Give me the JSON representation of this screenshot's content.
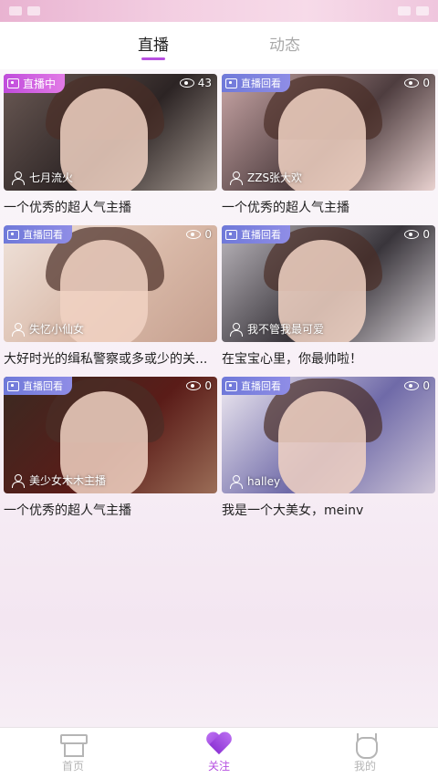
{
  "status_bar": {
    "left_text": "",
    "right_text": ""
  },
  "tabs": [
    {
      "label": "直播",
      "active": true
    },
    {
      "label": "动态",
      "active": false
    }
  ],
  "cards": [
    {
      "badge": "直播中",
      "badge_type": "live",
      "viewers": "43",
      "host": "七月流火",
      "title": "一个优秀的超人气主播",
      "bg": [
        "#6b5a55",
        "#2c2424",
        "#a39890"
      ]
    },
    {
      "badge": "直播回看",
      "badge_type": "replay",
      "viewers": "0",
      "host": "ZZS张大欢",
      "title": "一个优秀的超人气主播",
      "bg": [
        "#caa7a7",
        "#4e3d3f",
        "#e9d2d0"
      ]
    },
    {
      "badge": "直播回看",
      "badge_type": "replay",
      "viewers": "0",
      "host": "失忆小仙女",
      "title": "大好时光的缉私警察或多或少的关...",
      "bg": [
        "#efe2da",
        "#d9b9a8",
        "#c6a08f"
      ]
    },
    {
      "badge": "直播回看",
      "badge_type": "replay",
      "viewers": "0",
      "host": "我不管我最可爱",
      "title": "在宝宝心里，你最帅啦！",
      "bg": [
        "#bcb7bd",
        "#39353b",
        "#d7d1d6"
      ]
    },
    {
      "badge": "直播回看",
      "badge_type": "replay",
      "viewers": "0",
      "host": "美少女木木主播",
      "title": "一个优秀的超人气主播",
      "bg": [
        "#3a2a22",
        "#5a1c18",
        "#9b6d57"
      ]
    },
    {
      "badge": "直播回看",
      "badge_type": "replay",
      "viewers": "0",
      "host": "halley",
      "title": "我是一个大美女，meinv",
      "bg": [
        "#f0ebf2",
        "#6f6aa8",
        "#cfc6d8"
      ]
    }
  ],
  "bottom_nav": [
    {
      "label": "首页",
      "icon": "home-icon",
      "active": false
    },
    {
      "label": "关注",
      "icon": "heart-icon",
      "active": true
    },
    {
      "label": "我的",
      "icon": "cat-icon",
      "active": false
    }
  ],
  "colors": {
    "accent": "#b54fe0",
    "live_badge": "#c04bdc",
    "replay_badge": "#6f79d9"
  }
}
